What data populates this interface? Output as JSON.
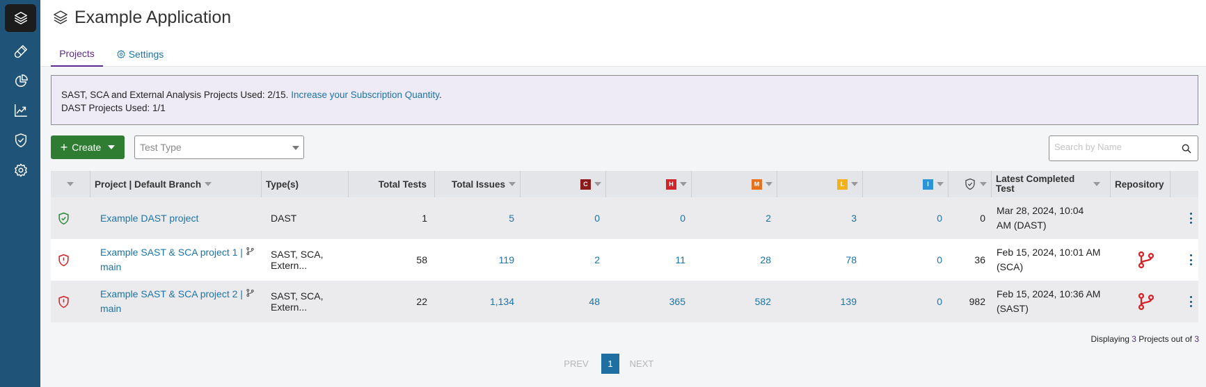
{
  "app": {
    "title": "Example Application"
  },
  "tabs": {
    "projects": "Projects",
    "settings": "Settings"
  },
  "banner": {
    "line1": "SAST, SCA and External Analysis Projects Used: 2/15.",
    "link": "Increase your Subscription Quantity",
    "line1_end": ".",
    "line2": "DAST Projects Used: 1/1"
  },
  "toolbar": {
    "create_label": "Create",
    "test_type_placeholder": "Test Type",
    "search_placeholder": "Search by Name"
  },
  "columns": {
    "project": "Project | Default Branch",
    "types": "Type(s)",
    "total_tests": "Total Tests",
    "total_issues": "Total Issues",
    "critical": "C",
    "high": "H",
    "medium": "M",
    "low": "L",
    "info": "I",
    "latest": "Latest Completed Test",
    "repository": "Repository"
  },
  "severity_colors": {
    "critical": "#8b1b1b",
    "high": "#d3242a",
    "medium": "#e8711c",
    "low": "#f3b21a",
    "info": "#2a94d6"
  },
  "rows": [
    {
      "status": "passed",
      "project": "Example DAST project",
      "branch": "",
      "types": "DAST",
      "total_tests": "1",
      "total_issues": "5",
      "critical": "0",
      "high": "0",
      "medium": "2",
      "low": "3",
      "info": "0",
      "policy": "0",
      "latest_line1": "Mar 28, 2024, 10:04",
      "latest_line2": "AM (DAST)",
      "repository": false
    },
    {
      "status": "failed",
      "project": "Example SAST & SCA project 1 |",
      "branch": "main",
      "types": "SAST, SCA, Extern...",
      "total_tests": "58",
      "total_issues": "119",
      "critical": "2",
      "high": "11",
      "medium": "28",
      "low": "78",
      "info": "0",
      "policy": "36",
      "latest_line1": "Feb 15, 2024, 10:01 AM",
      "latest_line2": "(SCA)",
      "repository": true
    },
    {
      "status": "failed",
      "project": "Example SAST & SCA project 2 |",
      "branch": "main",
      "types": "SAST, SCA, Extern...",
      "total_tests": "22",
      "total_issues": "1,134",
      "critical": "48",
      "high": "365",
      "medium": "582",
      "low": "139",
      "info": "0",
      "policy": "982",
      "latest_line1": "Feb 15, 2024, 10:36 AM",
      "latest_line2": "(SAST)",
      "repository": true
    }
  ],
  "footer": {
    "prefix": "Displaying",
    "shown": "3",
    "middle": "Projects out of",
    "total": "3"
  },
  "pagination": {
    "prev": "PREV",
    "current": "1",
    "next": "NEXT"
  }
}
